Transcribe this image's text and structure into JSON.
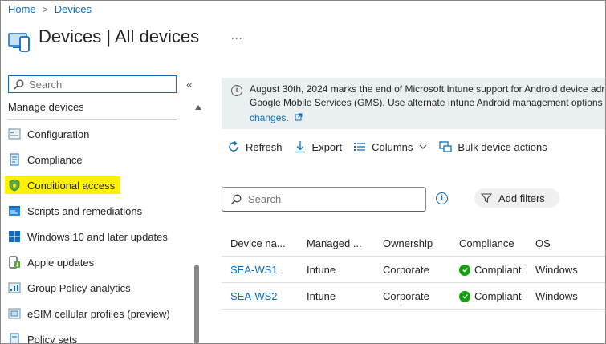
{
  "breadcrumb": {
    "home": "Home",
    "separator": ">",
    "current": "Devices"
  },
  "header": {
    "title": "Devices | All devices",
    "more": "..."
  },
  "sidebar": {
    "search_placeholder": "Search",
    "collapse": "«",
    "section": "Manage devices",
    "items": [
      {
        "label": "Configuration",
        "icon": "configuration-icon",
        "highlighted": false
      },
      {
        "label": "Compliance",
        "icon": "compliance-icon",
        "highlighted": false
      },
      {
        "label": "Conditional access",
        "icon": "shield-icon",
        "highlighted": true
      },
      {
        "label": "Scripts and remediations",
        "icon": "scripts-icon",
        "highlighted": false
      },
      {
        "label": "Windows 10 and later updates",
        "icon": "windows-icon",
        "highlighted": false
      },
      {
        "label": "Apple updates",
        "icon": "apple-updates-icon",
        "highlighted": false
      },
      {
        "label": "Group Policy analytics",
        "icon": "group-policy-icon",
        "highlighted": false
      },
      {
        "label": "eSIM cellular profiles (preview)",
        "icon": "esim-icon",
        "highlighted": false
      },
      {
        "label": "Policy sets",
        "icon": "policy-sets-icon",
        "highlighted": false
      }
    ]
  },
  "notice": {
    "line1": "August 30th, 2024 marks the end of Microsoft Intune support for Android device adr",
    "line2": "Google Mobile Services (GMS). Use alternate Intune Android management options in",
    "link": "changes."
  },
  "toolbar": {
    "refresh": "Refresh",
    "export": "Export",
    "columns": "Columns",
    "bulk": "Bulk device actions"
  },
  "search": {
    "placeholder": "Search"
  },
  "filters": {
    "label": "Add filters"
  },
  "table": {
    "headers": [
      "Device na...",
      "Managed ...",
      "Ownership",
      "Compliance",
      "OS"
    ],
    "rows": [
      {
        "device": "SEA-WS1",
        "managed": "Intune",
        "ownership": "Corporate",
        "compliance": "Compliant",
        "os": "Windows"
      },
      {
        "device": "SEA-WS2",
        "managed": "Intune",
        "ownership": "Corporate",
        "compliance": "Compliant",
        "os": "Windows"
      }
    ]
  },
  "colors": {
    "accent": "#0f6cbd",
    "highlight": "#fff100",
    "compliant": "#13a10e",
    "notice_bg": "#eaf0f2"
  }
}
